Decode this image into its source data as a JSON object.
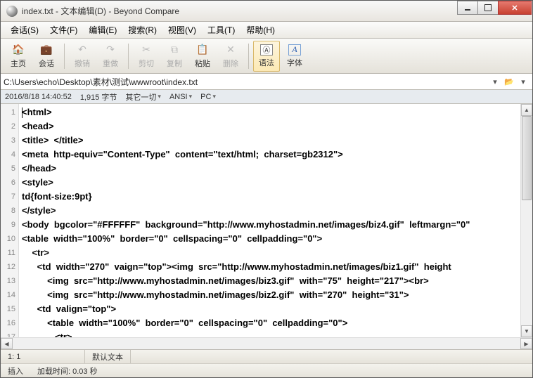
{
  "title": "index.txt - 文本编辑(D) - Beyond Compare",
  "menu": [
    "会话(S)",
    "文件(F)",
    "编辑(E)",
    "搜索(R)",
    "视图(V)",
    "工具(T)",
    "帮助(H)"
  ],
  "toolbar": [
    {
      "label": "主页",
      "icon": "🏠",
      "color": "#d9a22b"
    },
    {
      "label": "会话",
      "icon": "💼",
      "color": "#b07a3a"
    },
    {
      "sep": true
    },
    {
      "label": "撤销",
      "icon": "↶",
      "disabled": true
    },
    {
      "label": "重做",
      "icon": "↷",
      "disabled": true
    },
    {
      "sep": true
    },
    {
      "label": "剪切",
      "icon": "✂",
      "disabled": true
    },
    {
      "label": "复制",
      "icon": "⧉",
      "disabled": true
    },
    {
      "label": "粘贴",
      "icon": "📋",
      "color": "#c79a4a"
    },
    {
      "label": "删除",
      "icon": "✕",
      "disabled": true
    },
    {
      "sep": true
    },
    {
      "label": "语法",
      "icon": "Ⓐ",
      "active": true
    },
    {
      "label": "字体",
      "icon": "A",
      "italic": true,
      "color": "#2a5db0"
    }
  ],
  "path": "C:\\Users\\echo\\Desktop\\素材\\测试\\wwwroot\\index.txt",
  "info": {
    "datetime": "2016/8/18 14:40:52",
    "size": "1,915 字节",
    "encoding_label": "其它一切",
    "charset": "ANSI",
    "lineend": "PC"
  },
  "code_lines": [
    "<html>",
    "<head>",
    "<title>  </title>",
    "<meta  http-equiv=\"Content-Type\"  content=\"text/html;  charset=gb2312\">",
    "</head>",
    "<style>",
    "td{font-size:9pt}",
    "</style>",
    "<body  bgcolor=\"#FFFFFF\"  background=\"http://www.myhostadmin.net/images/biz4.gif\"  leftmargn=\"0\"",
    "<table  width=\"100%\"  border=\"0\"  cellspacing=\"0\"  cellpadding=\"0\">",
    "    <tr>",
    "      <td  width=\"270\"  vaign=\"top\"><img  src=\"http://www.myhostadmin.net/images/biz1.gif\"  height",
    "          <img  src=\"http://www.myhostadmin.net/images/biz3.gif\"  with=\"75\"  height=\"217\"><br>",
    "          <img  src=\"http://www.myhostadmin.net/images/biz2.gif\"  with=\"270\"  height=\"31\">",
    "      <td  valign=\"top\">",
    "          <table  width=\"100%\"  border=\"0\"  cellspacing=\"0\"  cellpadding=\"0\">",
    "             <tr>"
  ],
  "status": {
    "pos": "1: 1",
    "filetype": "默认文本",
    "mode": "插入",
    "loadtime": "加载时间: 0.03 秒"
  }
}
